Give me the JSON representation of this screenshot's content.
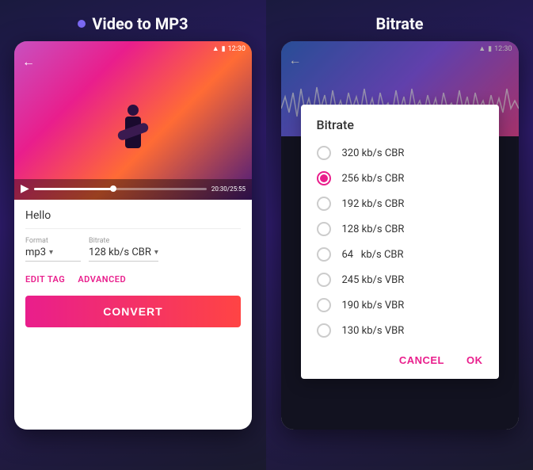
{
  "left": {
    "title": "Video to MP3",
    "title_dot": true,
    "status_bar": {
      "signal": "▲",
      "battery": "▮",
      "time": "12:30"
    },
    "video": {
      "back_arrow": "←",
      "progress_time": "20:30/25:55"
    },
    "card": {
      "file_name": "Hello",
      "format_label": "Format",
      "format_value": "mp3",
      "bitrate_label": "Bitrate",
      "bitrate_value": "128 kb/s CBR",
      "edit_tag": "EDIT TAG",
      "advanced": "ADVANCED",
      "convert": "CONVERT"
    }
  },
  "right": {
    "title": "Bitrate",
    "status_bar": {
      "signal": "▲",
      "battery": "▮",
      "time": "12:30"
    },
    "dialog": {
      "title": "Bitrate",
      "options": [
        {
          "label": "320 kb/s CBR",
          "selected": false
        },
        {
          "label": "256 kb/s CBR",
          "selected": true
        },
        {
          "label": "192 kb/s CBR",
          "selected": false
        },
        {
          "label": "128 kb/s CBR",
          "selected": false
        },
        {
          "label": "64   kb/s CBR",
          "selected": false
        },
        {
          "label": "245 kb/s VBR",
          "selected": false
        },
        {
          "label": "190 kb/s VBR",
          "selected": false
        },
        {
          "label": "130 kb/s VBR",
          "selected": false
        }
      ],
      "cancel": "CANCEL",
      "ok": "OK"
    }
  }
}
